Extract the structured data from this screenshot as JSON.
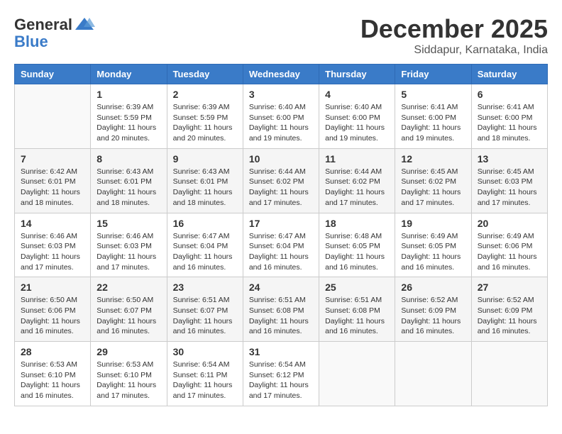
{
  "header": {
    "logo": {
      "general": "General",
      "blue": "Blue"
    },
    "title": "December 2025",
    "location": "Siddapur, Karnataka, India"
  },
  "calendar": {
    "weekdays": [
      "Sunday",
      "Monday",
      "Tuesday",
      "Wednesday",
      "Thursday",
      "Friday",
      "Saturday"
    ],
    "weeks": [
      [
        {
          "day": "",
          "info": ""
        },
        {
          "day": "1",
          "info": "Sunrise: 6:39 AM\nSunset: 5:59 PM\nDaylight: 11 hours\nand 20 minutes."
        },
        {
          "day": "2",
          "info": "Sunrise: 6:39 AM\nSunset: 5:59 PM\nDaylight: 11 hours\nand 20 minutes."
        },
        {
          "day": "3",
          "info": "Sunrise: 6:40 AM\nSunset: 6:00 PM\nDaylight: 11 hours\nand 19 minutes."
        },
        {
          "day": "4",
          "info": "Sunrise: 6:40 AM\nSunset: 6:00 PM\nDaylight: 11 hours\nand 19 minutes."
        },
        {
          "day": "5",
          "info": "Sunrise: 6:41 AM\nSunset: 6:00 PM\nDaylight: 11 hours\nand 19 minutes."
        },
        {
          "day": "6",
          "info": "Sunrise: 6:41 AM\nSunset: 6:00 PM\nDaylight: 11 hours\nand 18 minutes."
        }
      ],
      [
        {
          "day": "7",
          "info": "Sunrise: 6:42 AM\nSunset: 6:01 PM\nDaylight: 11 hours\nand 18 minutes."
        },
        {
          "day": "8",
          "info": "Sunrise: 6:43 AM\nSunset: 6:01 PM\nDaylight: 11 hours\nand 18 minutes."
        },
        {
          "day": "9",
          "info": "Sunrise: 6:43 AM\nSunset: 6:01 PM\nDaylight: 11 hours\nand 18 minutes."
        },
        {
          "day": "10",
          "info": "Sunrise: 6:44 AM\nSunset: 6:02 PM\nDaylight: 11 hours\nand 17 minutes."
        },
        {
          "day": "11",
          "info": "Sunrise: 6:44 AM\nSunset: 6:02 PM\nDaylight: 11 hours\nand 17 minutes."
        },
        {
          "day": "12",
          "info": "Sunrise: 6:45 AM\nSunset: 6:02 PM\nDaylight: 11 hours\nand 17 minutes."
        },
        {
          "day": "13",
          "info": "Sunrise: 6:45 AM\nSunset: 6:03 PM\nDaylight: 11 hours\nand 17 minutes."
        }
      ],
      [
        {
          "day": "14",
          "info": "Sunrise: 6:46 AM\nSunset: 6:03 PM\nDaylight: 11 hours\nand 17 minutes."
        },
        {
          "day": "15",
          "info": "Sunrise: 6:46 AM\nSunset: 6:03 PM\nDaylight: 11 hours\nand 17 minutes."
        },
        {
          "day": "16",
          "info": "Sunrise: 6:47 AM\nSunset: 6:04 PM\nDaylight: 11 hours\nand 16 minutes."
        },
        {
          "day": "17",
          "info": "Sunrise: 6:47 AM\nSunset: 6:04 PM\nDaylight: 11 hours\nand 16 minutes."
        },
        {
          "day": "18",
          "info": "Sunrise: 6:48 AM\nSunset: 6:05 PM\nDaylight: 11 hours\nand 16 minutes."
        },
        {
          "day": "19",
          "info": "Sunrise: 6:49 AM\nSunset: 6:05 PM\nDaylight: 11 hours\nand 16 minutes."
        },
        {
          "day": "20",
          "info": "Sunrise: 6:49 AM\nSunset: 6:06 PM\nDaylight: 11 hours\nand 16 minutes."
        }
      ],
      [
        {
          "day": "21",
          "info": "Sunrise: 6:50 AM\nSunset: 6:06 PM\nDaylight: 11 hours\nand 16 minutes."
        },
        {
          "day": "22",
          "info": "Sunrise: 6:50 AM\nSunset: 6:07 PM\nDaylight: 11 hours\nand 16 minutes."
        },
        {
          "day": "23",
          "info": "Sunrise: 6:51 AM\nSunset: 6:07 PM\nDaylight: 11 hours\nand 16 minutes."
        },
        {
          "day": "24",
          "info": "Sunrise: 6:51 AM\nSunset: 6:08 PM\nDaylight: 11 hours\nand 16 minutes."
        },
        {
          "day": "25",
          "info": "Sunrise: 6:51 AM\nSunset: 6:08 PM\nDaylight: 11 hours\nand 16 minutes."
        },
        {
          "day": "26",
          "info": "Sunrise: 6:52 AM\nSunset: 6:09 PM\nDaylight: 11 hours\nand 16 minutes."
        },
        {
          "day": "27",
          "info": "Sunrise: 6:52 AM\nSunset: 6:09 PM\nDaylight: 11 hours\nand 16 minutes."
        }
      ],
      [
        {
          "day": "28",
          "info": "Sunrise: 6:53 AM\nSunset: 6:10 PM\nDaylight: 11 hours\nand 16 minutes."
        },
        {
          "day": "29",
          "info": "Sunrise: 6:53 AM\nSunset: 6:10 PM\nDaylight: 11 hours\nand 17 minutes."
        },
        {
          "day": "30",
          "info": "Sunrise: 6:54 AM\nSunset: 6:11 PM\nDaylight: 11 hours\nand 17 minutes."
        },
        {
          "day": "31",
          "info": "Sunrise: 6:54 AM\nSunset: 6:12 PM\nDaylight: 11 hours\nand 17 minutes."
        },
        {
          "day": "",
          "info": ""
        },
        {
          "day": "",
          "info": ""
        },
        {
          "day": "",
          "info": ""
        }
      ]
    ]
  }
}
